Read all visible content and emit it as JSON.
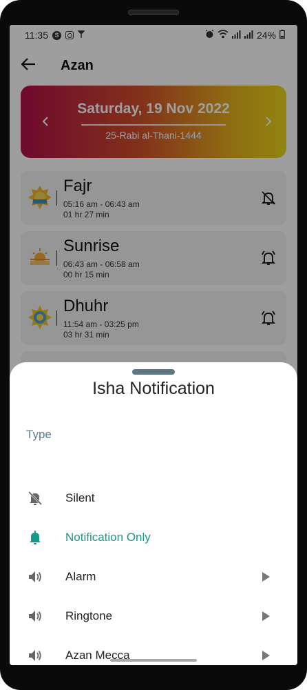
{
  "status_bar": {
    "time": "11:35",
    "battery": "24%",
    "icons": [
      "skype-icon",
      "instagram-icon",
      "antenna-icon",
      "alarm-icon",
      "wifi-icon",
      "signal-icon",
      "signal-icon-2",
      "battery-icon"
    ]
  },
  "app_bar": {
    "title": "Azan",
    "back_icon": "back-arrow-icon"
  },
  "date_banner": {
    "gregorian": "Saturday, 19 Nov 2022",
    "hijri": "25-Rabi al-Thani-1444",
    "prev_icon": "chevron-left-icon",
    "next_icon": "chevron-right-icon",
    "gradient": [
      "#b40f4a",
      "#e8d61a"
    ]
  },
  "prayers": [
    {
      "name": "Fajr",
      "range": "05:16 am - 06:43 am",
      "duration": "01 hr 27 min",
      "bell": "bell-off-icon"
    },
    {
      "name": "Sunrise",
      "range": "06:43 am - 06:58 am",
      "duration": "00 hr 15 min",
      "bell": "bell-ring-icon"
    },
    {
      "name": "Dhuhr",
      "range": "11:54 am - 03:25 pm",
      "duration": "03 hr 31 min",
      "bell": "bell-ring-icon"
    }
  ],
  "sheet": {
    "title": "Isha Notification",
    "section_label": "Type",
    "accent": "#17998a",
    "options": [
      {
        "label": "Silent",
        "icon": "bell-off-icon",
        "selected": false,
        "has_arrow": false
      },
      {
        "label": "Notification Only",
        "icon": "bell-icon",
        "selected": true,
        "has_arrow": false
      },
      {
        "label": "Alarm",
        "icon": "speaker-icon",
        "selected": false,
        "has_arrow": true
      },
      {
        "label": "Ringtone",
        "icon": "speaker-icon",
        "selected": false,
        "has_arrow": true
      },
      {
        "label": "Azan Mecca",
        "icon": "speaker-icon",
        "selected": false,
        "has_arrow": true
      }
    ]
  }
}
